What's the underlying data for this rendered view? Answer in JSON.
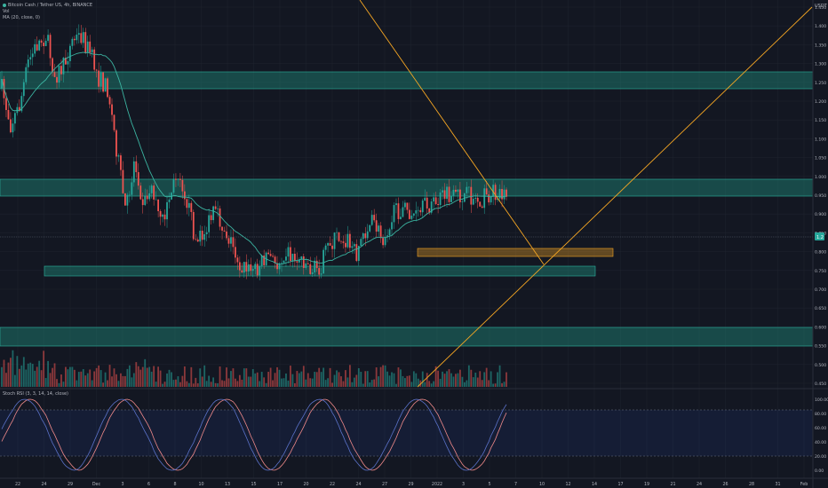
{
  "legend": {
    "line1": "Bitcoin Cash / Tether US, 4h, BINANCE",
    "line2": "Vol",
    "line3": "MA (20, close, 0)"
  },
  "stoch": {
    "label": "Stoch RSI (3, 3, 14, 14, close)",
    "levels": [
      80,
      20
    ],
    "scale": [
      "100.00",
      "80.00",
      "60.00",
      "40.00",
      "20.00",
      "0.00"
    ]
  },
  "price_axis": {
    "currency": "USDT",
    "ticks": [
      1.45,
      1.4,
      1.35,
      1.3,
      1.25,
      1.2,
      1.15,
      1.1,
      1.05,
      1.0,
      0.95,
      0.9,
      0.85,
      0.8,
      0.75,
      0.7,
      0.65,
      0.6,
      0.55,
      0.5,
      0.45
    ],
    "current_price": "1.2"
  },
  "time_axis": [
    "22",
    "24",
    "29",
    "Dec",
    "3",
    "6",
    "8",
    "10",
    "13",
    "15",
    "17",
    "20",
    "22",
    "24",
    "27",
    "29",
    "2022",
    "3",
    "5",
    "7",
    "10",
    "12",
    "14",
    "17",
    "19",
    "21",
    "24",
    "26",
    "28",
    "31",
    "Feb"
  ],
  "colors": {
    "background": "#131722",
    "up": "#26a69a",
    "down": "#ef5350",
    "zone": "#1f8a7b",
    "orange": "#f5a623",
    "ma": "#3bb3a0",
    "stoch_k": "#5b72c9",
    "stoch_d": "#f08a8a"
  },
  "chart_data": {
    "type": "candlestick",
    "close_path": [
      3.3,
      2.9,
      3.1,
      3.6,
      3.8,
      3.9,
      3.45,
      3.55,
      3.85,
      3.9,
      3.7,
      3.4,
      3.3,
      2.6,
      1.9,
      2.5,
      2.0,
      2.2,
      1.75,
      2.1,
      2.4,
      2.0,
      1.55,
      1.7,
      1.9,
      1.75,
      1.55,
      1.3,
      1.25,
      1.3,
      1.45,
      1.3,
      1.5,
      1.38,
      1.4,
      1.25,
      1.3,
      1.55,
      1.65,
      1.6,
      1.45,
      1.7,
      1.8,
      1.6,
      1.85,
      1.95,
      1.9,
      1.85,
      2.0,
      2.0,
      2.1,
      2.05,
      2.1,
      2.08,
      2.05,
      2.1,
      2.15,
      2.1
    ],
    "support_resistance_zones": [
      {
        "low": 1.15,
        "high": 1.27
      },
      {
        "low": 0.55,
        "high": 0.61
      },
      {
        "low": 0.25,
        "high": 0.36
      },
      {
        "low": 0.38,
        "high": 0.42
      },
      {
        "low": -0.33,
        "high": -0.21
      }
    ]
  }
}
